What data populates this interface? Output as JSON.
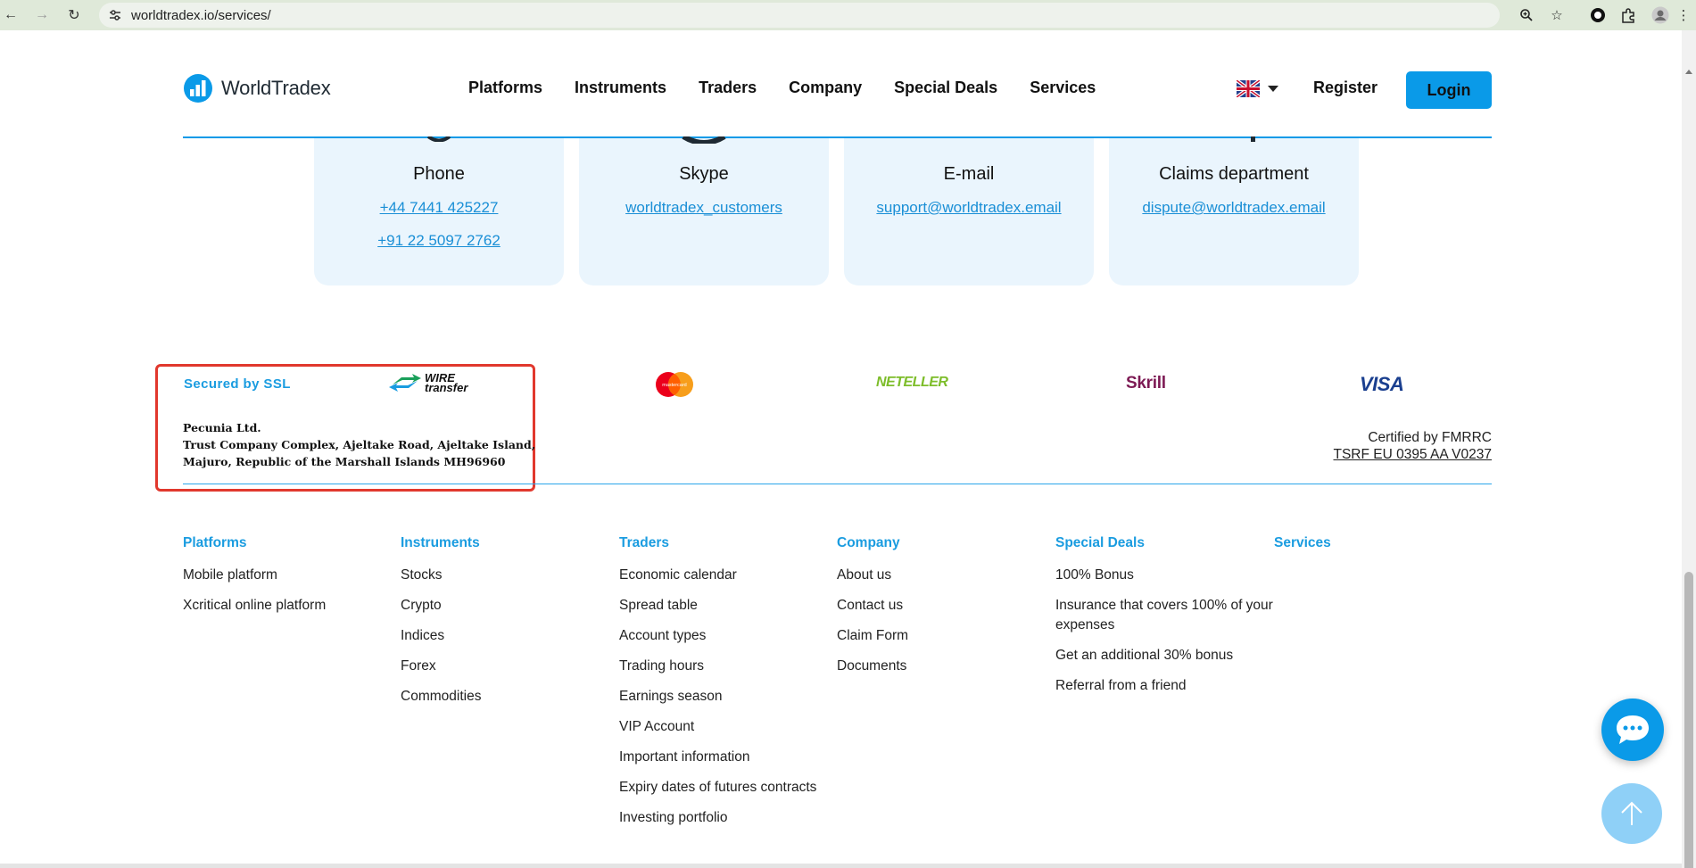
{
  "browser": {
    "url": "worldtradex.io/services/"
  },
  "header": {
    "logo_text": "WorldTradex",
    "nav": [
      "Platforms",
      "Instruments",
      "Traders",
      "Company",
      "Special Deals",
      "Services"
    ],
    "register_label": "Register",
    "login_label": "Login",
    "accent_color": "#0a9ae8"
  },
  "contacts": [
    {
      "title": "Phone",
      "links": [
        "+44 7441 425227",
        "+91 22 5097 2762"
      ]
    },
    {
      "title": "Skype",
      "links": [
        "worldtradex_customers"
      ]
    },
    {
      "title": "E-mail",
      "links": [
        "support@worldtradex.email"
      ]
    },
    {
      "title": "Claims department",
      "links": [
        "dispute@worldtradex.email"
      ]
    }
  ],
  "payments": {
    "ssl_label": "Secured by SSL",
    "wire_label_top": "WIRE",
    "wire_label_bottom": "transfer",
    "mastercard_label": "mastercard",
    "neteller_label": "NETELLER",
    "skrill_label": "Skrill",
    "visa_label": "VISA"
  },
  "company_address": {
    "line1": "Pecunia Ltd.",
    "line2": "Trust Company Complex, Ajeltake Road, Ajeltake Island,",
    "line3": "Majuro, Republic of the Marshall Islands MH96960"
  },
  "certification": {
    "text": "Certified by FMRRC",
    "link": "TSRF EU 0395 AA V0237"
  },
  "footer": {
    "columns": [
      {
        "title": "Platforms",
        "items": [
          "Mobile platform",
          "Xcritical online platform"
        ]
      },
      {
        "title": "Instruments",
        "items": [
          "Stocks",
          "Crypto",
          "Indices",
          "Forex",
          "Commodities"
        ]
      },
      {
        "title": "Traders",
        "items": [
          "Economic calendar",
          "Spread table",
          "Account types",
          "Trading hours",
          "Earnings season",
          "VIP Account",
          "Important information",
          "Expiry dates of futures contracts",
          "Investing portfolio"
        ]
      },
      {
        "title": "Company",
        "items": [
          "About us",
          "Contact us",
          "Claim Form",
          "Documents"
        ]
      },
      {
        "title": "Special Deals",
        "items": [
          "100% Bonus",
          "Insurance that covers 100% of your expenses",
          "Get an additional 30% bonus",
          "Referral from a friend"
        ]
      },
      {
        "title": "Services",
        "items": []
      }
    ]
  },
  "icons": {
    "back": "arrow-left-icon",
    "forward": "arrow-right-icon",
    "reload": "reload-icon",
    "site_info": "tune-icon",
    "zoom": "zoom-icon",
    "bookmark": "star-icon",
    "chat": "chat-bubble-icon",
    "scroll_top": "arrow-up-icon"
  }
}
